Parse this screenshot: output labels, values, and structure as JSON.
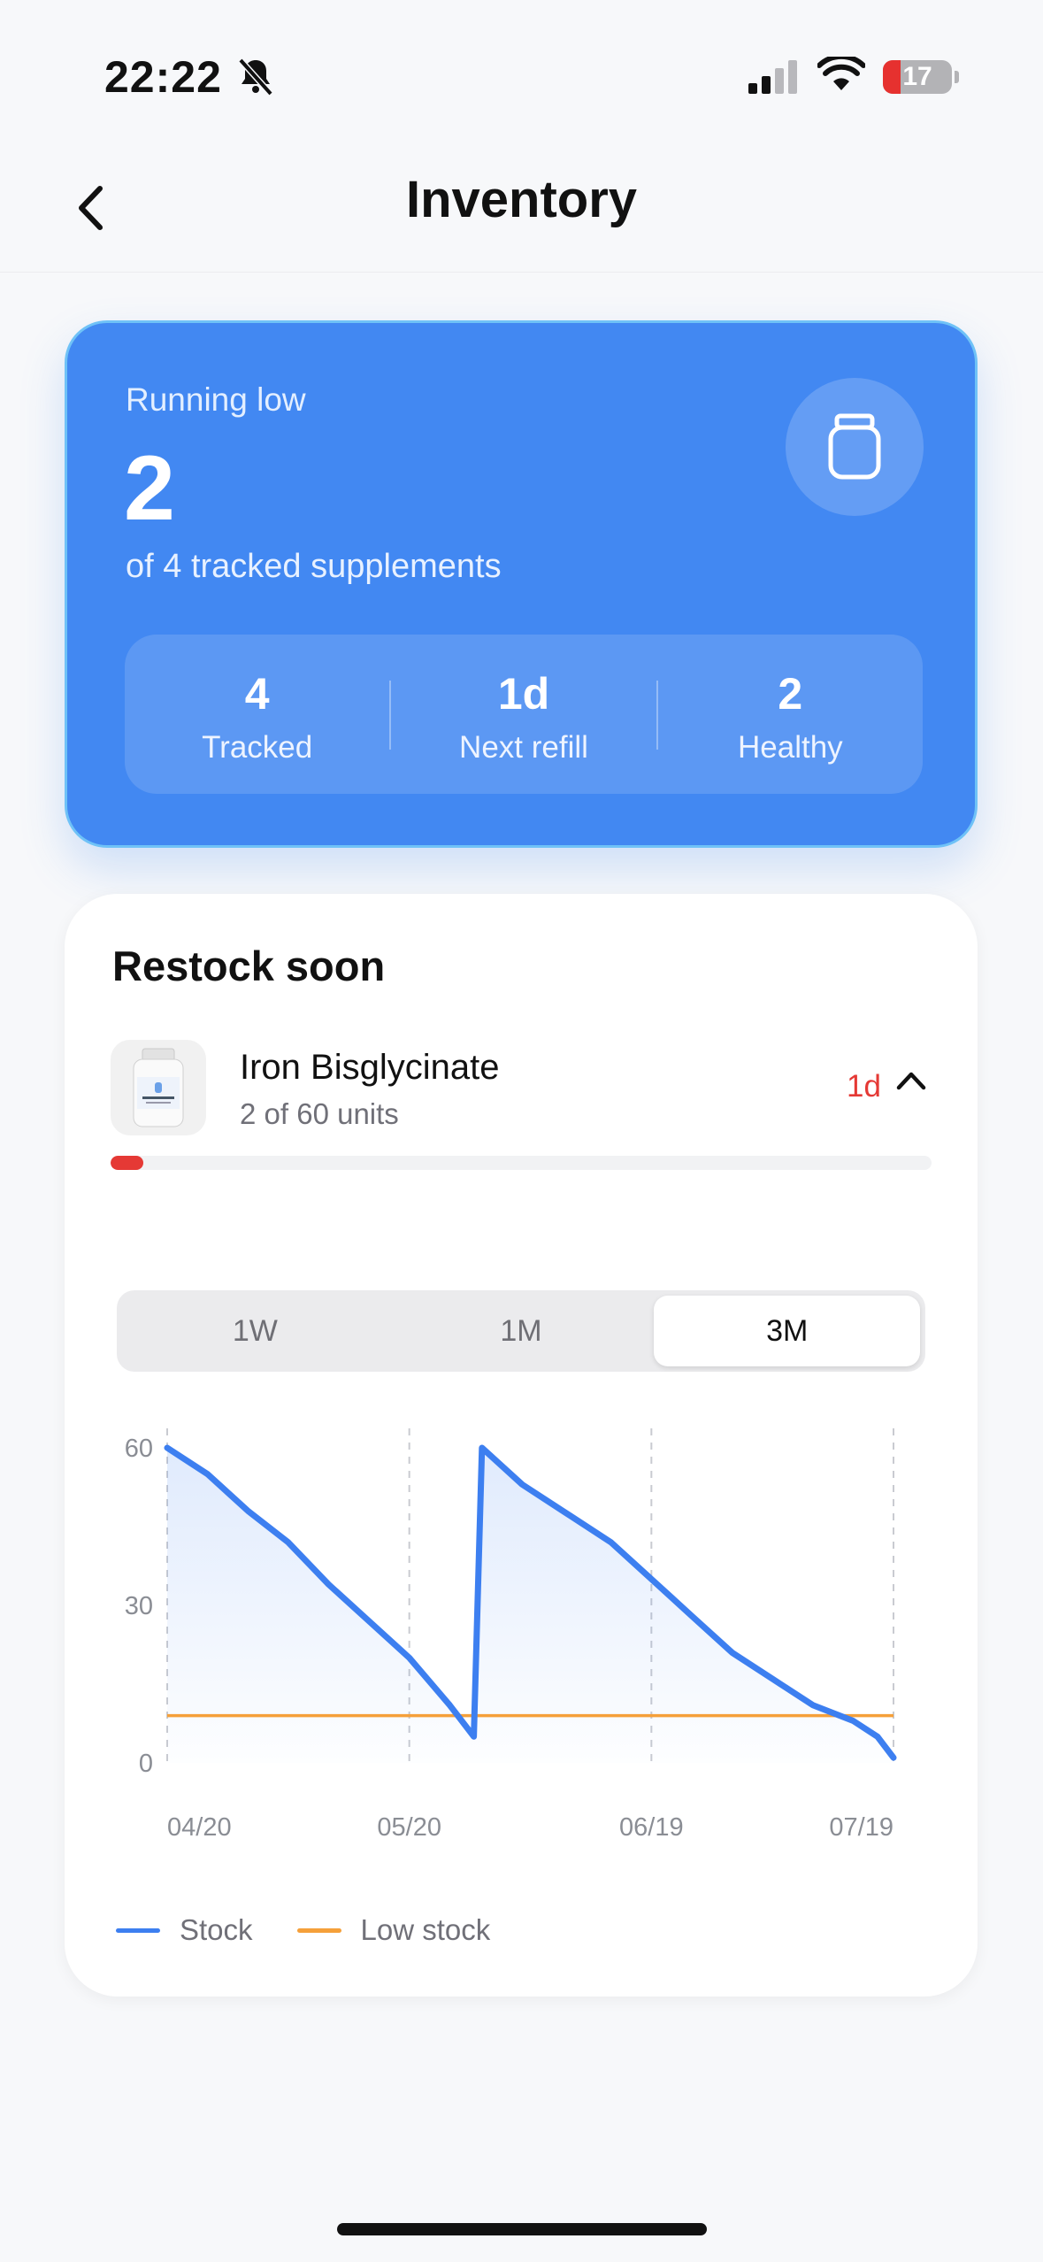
{
  "status_bar": {
    "time": "22:22",
    "battery": "17"
  },
  "header": {
    "title": "Inventory"
  },
  "summary": {
    "label": "Running low",
    "count": "2",
    "subtitle": "of 4 tracked supplements",
    "stats": [
      {
        "value": "4",
        "label": "Tracked"
      },
      {
        "value": "1d",
        "label": "Next refill"
      },
      {
        "value": "2",
        "label": "Healthy"
      }
    ]
  },
  "restock": {
    "title": "Restock soon",
    "item": {
      "name": "Iron Bisglycinate",
      "units": "2 of 60 units",
      "days_left": "1d",
      "stock_fraction": 0.04
    },
    "ranges": [
      {
        "label": "1W",
        "active": false
      },
      {
        "label": "1M",
        "active": false
      },
      {
        "label": "3M",
        "active": true
      }
    ]
  },
  "colors": {
    "accent": "#4288f2",
    "stock": "#3d7ff0",
    "low_stock": "#f5a03a",
    "alert": "#e53935"
  },
  "chart_data": {
    "type": "line",
    "x_ticks": [
      "04/20",
      "05/20",
      "06/19",
      "07/19"
    ],
    "y_ticks": [
      0,
      30,
      60
    ],
    "ylim": [
      0,
      60
    ],
    "x_range": [
      "04/20",
      "07/19"
    ],
    "grid": "vertical dashed lines at x ticks",
    "series": [
      {
        "name": "Stock",
        "x": [
          "04/20",
          "04/25",
          "04/30",
          "05/05",
          "05/10",
          "05/15",
          "05/20",
          "05/25",
          "05/28",
          "05/29",
          "06/03",
          "06/09",
          "06/14",
          "06/19",
          "06/24",
          "06/29",
          "07/04",
          "07/09",
          "07/14",
          "07/17",
          "07/19"
        ],
        "values": [
          60,
          55,
          48,
          42,
          34,
          27,
          20,
          11,
          5,
          60,
          53,
          47,
          42,
          35,
          28,
          21,
          16,
          11,
          8,
          5,
          1
        ]
      },
      {
        "name": "Low stock",
        "x": [
          "04/20",
          "07/19"
        ],
        "values": [
          9,
          9
        ]
      }
    ],
    "legend": [
      "Stock",
      "Low stock"
    ],
    "legend_position": "bottom-left"
  }
}
